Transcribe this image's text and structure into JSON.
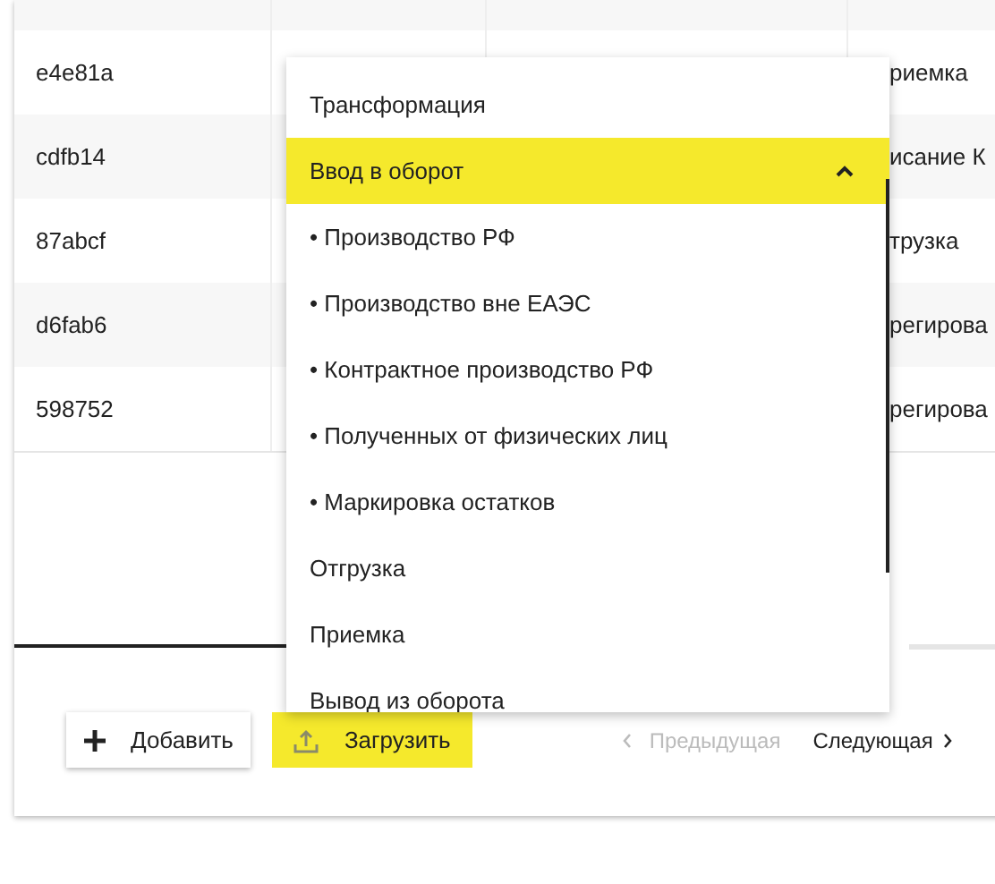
{
  "table": {
    "rows": [
      {
        "id": "e4e81a",
        "last": "риемка"
      },
      {
        "id": "cdfb14",
        "last": "исание К"
      },
      {
        "id": "87abcf",
        "last": "трузка"
      },
      {
        "id": "d6fab6",
        "last": "регирова"
      },
      {
        "id": "598752",
        "last": "регирова"
      }
    ]
  },
  "dropdown": {
    "items": [
      {
        "label": "Трансформация",
        "kind": "group",
        "expanded": false,
        "selected": false
      },
      {
        "label": "Ввод в оборот",
        "kind": "group",
        "expanded": true,
        "selected": true
      },
      {
        "label": "• Производство РФ",
        "kind": "sub",
        "selected": false
      },
      {
        "label": "• Производство вне ЕАЭС",
        "kind": "sub",
        "selected": false
      },
      {
        "label": "• Контрактное производство РФ",
        "kind": "sub",
        "selected": false
      },
      {
        "label": "• Полученных от физических лиц",
        "kind": "sub",
        "selected": false
      },
      {
        "label": "• Маркировка остатков",
        "kind": "sub",
        "selected": false
      },
      {
        "label": "Отгрузка",
        "kind": "group",
        "expanded": false,
        "selected": false
      },
      {
        "label": "Приемка",
        "kind": "group",
        "expanded": false,
        "selected": false
      },
      {
        "label": "Вывод из оборота",
        "kind": "group",
        "expanded": false,
        "selected": false
      }
    ]
  },
  "buttons": {
    "add": "Добавить",
    "upload": "Загрузить"
  },
  "pagination": {
    "previous": {
      "label": "Предыдущая",
      "disabled": true
    },
    "next": {
      "label": "Следующая",
      "disabled": false
    }
  }
}
